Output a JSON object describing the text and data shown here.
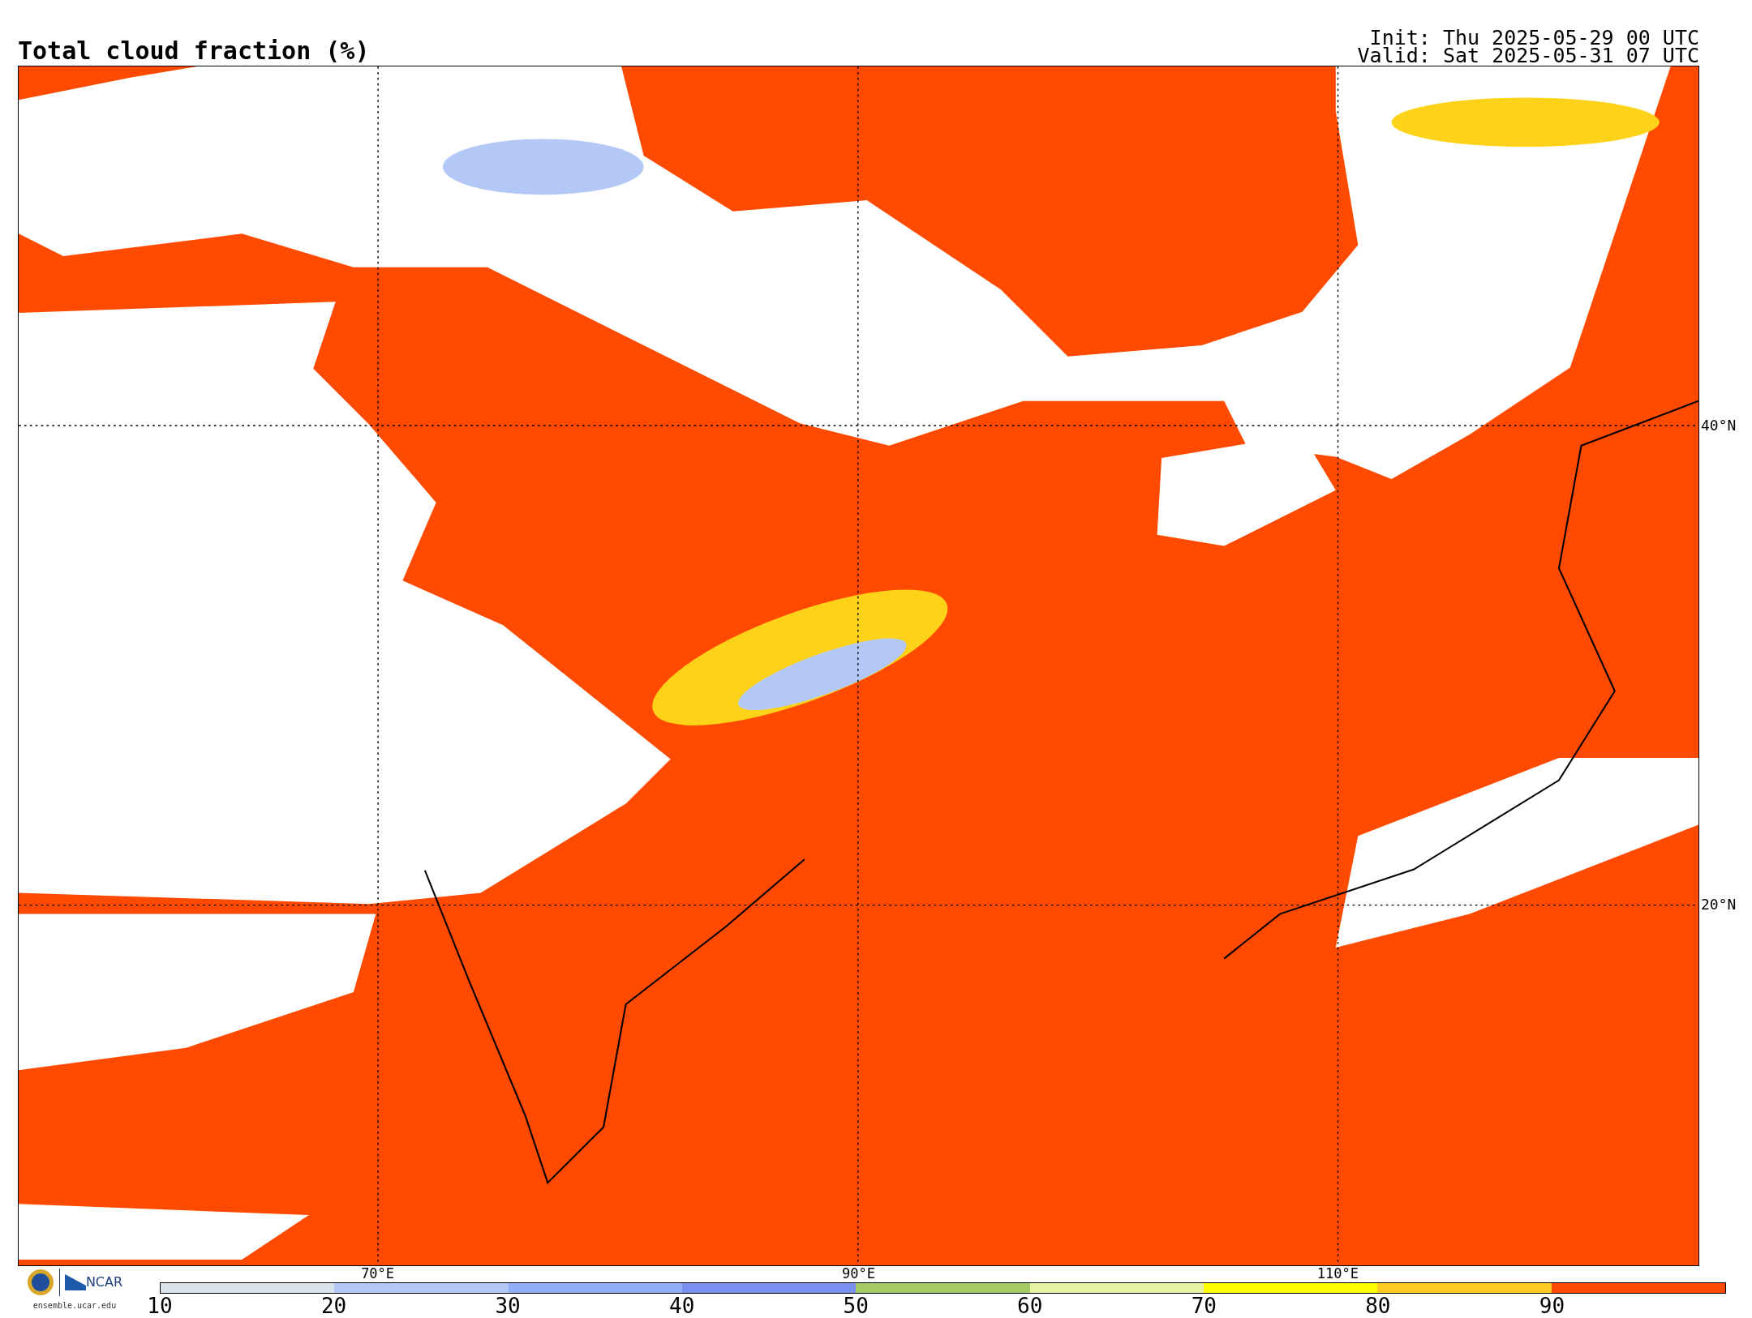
{
  "title": "Total cloud fraction (%)",
  "init": "Init: Thu 2025-05-29 00 UTC",
  "valid": "Valid: Sat 2025-05-31 07 UTC",
  "map": {
    "lat_labels": [
      "40°N",
      "20°N"
    ],
    "lon_labels": [
      "70°E",
      "90°E",
      "110°E"
    ]
  },
  "logo": {
    "name": "NCAR",
    "site": "ensemble.ucar.edu"
  },
  "colorbar": [
    {
      "label": "10",
      "color": "#d9e3ec"
    },
    {
      "label": "20",
      "color": "#b3c8f7"
    },
    {
      "label": "30",
      "color": "#8fb0f6"
    },
    {
      "label": "40",
      "color": "#7b91f2"
    },
    {
      "label": "50",
      "color": "#a5cc64"
    },
    {
      "label": "60",
      "color": "#e8f3a3"
    },
    {
      "label": "70",
      "color": "#ffff00"
    },
    {
      "label": "80",
      "color": "#ffcb22"
    },
    {
      "label": "90",
      "color": "#ff4a00"
    }
  ]
}
